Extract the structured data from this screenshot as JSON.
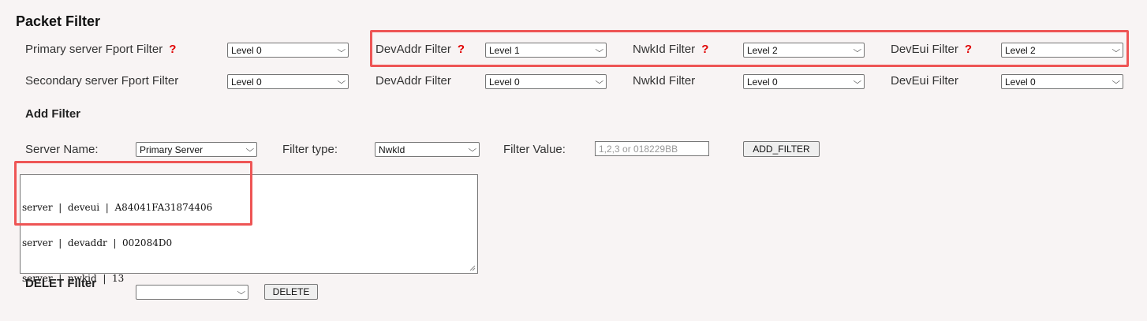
{
  "title": "Packet Filter",
  "row1": {
    "primary_label": "Primary server Fport Filter",
    "primary_value": "Level 0",
    "devaddr_label": "DevAddr Filter",
    "devaddr_value": "Level 1",
    "nwkid_label": "NwkId Filter",
    "nwkid_value": "Level 2",
    "deveui_label": "DevEui Filter",
    "deveui_value": "Level 2",
    "help_glyph": "?"
  },
  "row2": {
    "secondary_label": "Secondary server Fport Filter",
    "secondary_value": "Level 0",
    "devaddr_label": "DevAddr Filter",
    "devaddr_value": "Level 0",
    "nwkid_label": "NwkId Filter",
    "nwkid_value": "Level 0",
    "deveui_label": "DevEui Filter",
    "deveui_value": "Level 0"
  },
  "add_filter": {
    "heading": "Add Filter",
    "server_name_label": "Server Name:",
    "server_name_value": "Primary Server",
    "filter_type_label": "Filter type:",
    "filter_type_value": "NwkId",
    "filter_value_label": "Filter Value:",
    "filter_value_placeholder": "1,2,3 or 018229BB",
    "add_button": "ADD_FILTER"
  },
  "filter_list": {
    "lines": [
      "server  |  deveui  |  A84041FA31874406",
      "server  |  devaddr  |  002084D0",
      "server  |  nwkid  |  13"
    ]
  },
  "delete_filter": {
    "heading": "DELET Filter",
    "select_value": "",
    "delete_button": "DELETE"
  },
  "colors": {
    "highlight": "#ee5555",
    "help_icon": "#e00000",
    "background": "#f8f4f4"
  }
}
